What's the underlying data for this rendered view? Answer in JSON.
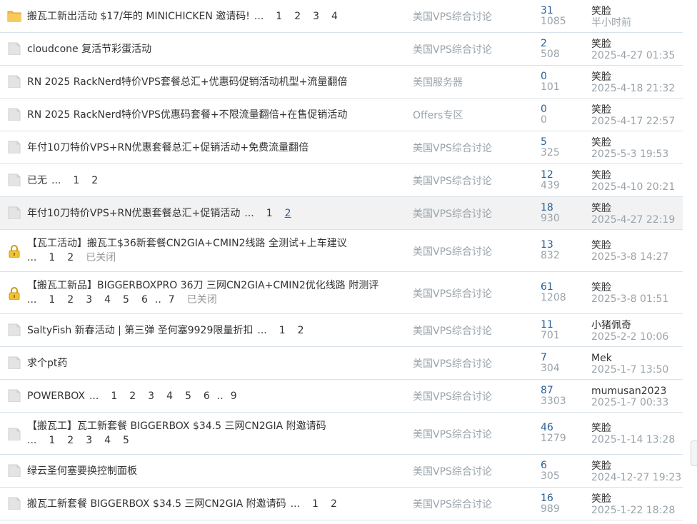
{
  "threads": [
    {
      "icon": "folder-new-icon",
      "title": "搬瓦工新出活动 $17/年的 MINICHICKEN 邀请码!",
      "pages": [
        "...",
        "1",
        "2",
        "3",
        "4"
      ],
      "link_page": "",
      "closed": "",
      "forum": "美国VPS综合讨论",
      "replies": "31",
      "views": "1085",
      "author": "笑脸",
      "time": "半小时前",
      "tall": false,
      "highlight": false,
      "two_line": false
    },
    {
      "icon": "thread-icon",
      "title": "cloudcone 复活节彩蛋活动",
      "pages": [],
      "link_page": "",
      "closed": "",
      "forum": "美国VPS综合讨论",
      "replies": "2",
      "views": "508",
      "author": "笑脸",
      "time": "2025-4-27 01:35",
      "tall": false,
      "highlight": false,
      "two_line": false
    },
    {
      "icon": "thread-icon",
      "title": "RN 2025 RackNerd特价VPS套餐总汇+优惠码促销活动机型+流量翻倍",
      "pages": [],
      "link_page": "",
      "closed": "",
      "forum": "美国服务器",
      "replies": "0",
      "views": "101",
      "author": "笑脸",
      "time": "2025-4-18 21:32",
      "tall": false,
      "highlight": false,
      "two_line": false
    },
    {
      "icon": "thread-icon",
      "title": "RN 2025 RackNerd特价VPS优惠码套餐+不限流量翻倍+在售促销活动",
      "pages": [],
      "link_page": "",
      "closed": "",
      "forum": "Offers专区",
      "replies": "0",
      "views": "0",
      "author": "笑脸",
      "time": "2025-4-17 22:57",
      "tall": false,
      "highlight": false,
      "two_line": false
    },
    {
      "icon": "thread-icon",
      "title": "年付10刀特价VPS+RN优惠套餐总汇+促销活动+免费流量翻倍",
      "pages": [],
      "link_page": "",
      "closed": "",
      "forum": "美国VPS综合讨论",
      "replies": "5",
      "views": "325",
      "author": "笑脸",
      "time": "2025-5-3 19:53",
      "tall": false,
      "highlight": false,
      "two_line": false
    },
    {
      "icon": "thread-icon",
      "title": "已无",
      "pages": [
        "...",
        "1",
        "2"
      ],
      "link_page": "",
      "closed": "",
      "forum": "美国VPS综合讨论",
      "replies": "12",
      "views": "439",
      "author": "笑脸",
      "time": "2025-4-10 20:21",
      "tall": false,
      "highlight": false,
      "two_line": false
    },
    {
      "icon": "thread-icon",
      "title": "年付10刀特价VPS+RN优惠套餐总汇+促销活动",
      "pages": [
        "...",
        "1"
      ],
      "link_page": "2",
      "closed": "",
      "forum": "美国VPS综合讨论",
      "replies": "18",
      "views": "930",
      "author": "笑脸",
      "time": "2025-4-27 22:19",
      "tall": false,
      "highlight": true,
      "two_line": false
    },
    {
      "icon": "lock-icon",
      "title": "【瓦工活动】搬瓦工$36新套餐CN2GIA+CMIN2线路 全测试+上车建议",
      "pages": [
        "...",
        "1",
        "2"
      ],
      "link_page": "",
      "closed": "已关闭",
      "forum": "美国VPS综合讨论",
      "replies": "13",
      "views": "832",
      "author": "笑脸",
      "time": "2025-3-8 14:27",
      "tall": true,
      "highlight": false,
      "two_line": true
    },
    {
      "icon": "lock-icon",
      "title": "【搬瓦工新品】BIGGERBOXPRO 36刀 三网CN2GIA+CMIN2优化线路 附测评",
      "pages": [
        "...",
        "1",
        "2",
        "3",
        "4",
        "5",
        "6",
        "..",
        "7"
      ],
      "link_page": "",
      "closed": "已关闭",
      "forum": "美国VPS综合讨论",
      "replies": "61",
      "views": "1208",
      "author": "笑脸",
      "time": "2025-3-8 01:51",
      "tall": true,
      "highlight": false,
      "two_line": true
    },
    {
      "icon": "thread-icon",
      "title": "SaltyFish 新春活动 | 第三弹 圣何塞9929限量折扣",
      "pages": [
        "...",
        "1",
        "2"
      ],
      "link_page": "",
      "closed": "",
      "forum": "美国VPS综合讨论",
      "replies": "11",
      "views": "701",
      "author": "小猪佩奇",
      "time": "2025-2-2 10:06",
      "tall": false,
      "highlight": false,
      "two_line": false
    },
    {
      "icon": "thread-icon",
      "title": "求个pt药",
      "pages": [],
      "link_page": "",
      "closed": "",
      "forum": "美国VPS综合讨论",
      "replies": "7",
      "views": "304",
      "author": "Mek",
      "time": "2025-1-7 13:50",
      "tall": false,
      "highlight": false,
      "two_line": false
    },
    {
      "icon": "thread-icon",
      "title": "POWERBOX",
      "pages": [
        "...",
        "1",
        "2",
        "3",
        "4",
        "5",
        "6",
        "..",
        "9"
      ],
      "link_page": "",
      "closed": "",
      "forum": "美国VPS综合讨论",
      "replies": "87",
      "views": "3303",
      "author": "mumusan2023",
      "time": "2025-1-7 00:33",
      "tall": false,
      "highlight": false,
      "two_line": false
    },
    {
      "icon": "thread-icon",
      "title": "【搬瓦工】瓦工新套餐 BIGGERBOX $34.5 三网CN2GIA 附邀请码",
      "pages": [
        "...",
        "1",
        "2",
        "3",
        "4",
        "5"
      ],
      "link_page": "",
      "closed": "",
      "forum": "美国VPS综合讨论",
      "replies": "46",
      "views": "1279",
      "author": "笑脸",
      "time": "2025-1-14 13:28",
      "tall": true,
      "highlight": false,
      "two_line": true
    },
    {
      "icon": "thread-icon",
      "title": "绿云圣何塞要换控制面板",
      "pages": [],
      "link_page": "",
      "closed": "",
      "forum": "美国VPS综合讨论",
      "replies": "6",
      "views": "305",
      "author": "笑脸",
      "time": "2024-12-27 19:23",
      "tall": false,
      "highlight": false,
      "two_line": false
    },
    {
      "icon": "thread-icon",
      "title": "搬瓦工新套餐 BIGGERBOX $34.5 三网CN2GIA 附邀请码",
      "pages": [
        "...",
        "1",
        "2"
      ],
      "link_page": "",
      "closed": "",
      "forum": "美国VPS综合讨论",
      "replies": "16",
      "views": "989",
      "author": "笑脸",
      "time": "2025-1-22 18:28",
      "tall": false,
      "highlight": false,
      "two_line": false
    }
  ]
}
